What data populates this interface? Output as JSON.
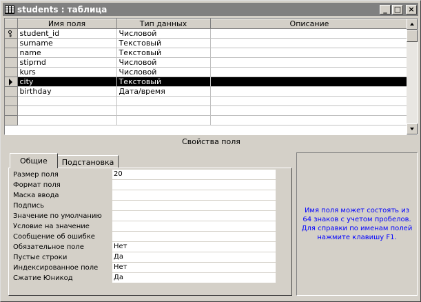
{
  "window": {
    "title": "students : таблица"
  },
  "columns": {
    "field_name": "Имя поля",
    "data_type": "Тип данных",
    "description": "Описание"
  },
  "fields": [
    {
      "name": "student_id",
      "type": "Числовой",
      "description": ""
    },
    {
      "name": "surname",
      "type": "Текстовый",
      "description": ""
    },
    {
      "name": "name",
      "type": "Текстовый",
      "description": ""
    },
    {
      "name": "stiprnd",
      "type": "Числовой",
      "description": ""
    },
    {
      "name": "kurs",
      "type": "Числовой",
      "description": ""
    },
    {
      "name": "city",
      "type": "Текстовый",
      "description": ""
    },
    {
      "name": "birthday",
      "type": "Дата/время",
      "description": ""
    }
  ],
  "selected_field": "city",
  "primary_key": "student_id",
  "properties_caption": "Свойства поля",
  "tabs": [
    {
      "label": "Общие"
    },
    {
      "label": "Подстановка"
    }
  ],
  "properties": [
    {
      "label": "Размер поля",
      "value": "20"
    },
    {
      "label": "Формат поля",
      "value": ""
    },
    {
      "label": "Маска ввода",
      "value": ""
    },
    {
      "label": "Подпись",
      "value": ""
    },
    {
      "label": "Значение по умолчанию",
      "value": ""
    },
    {
      "label": "Условие на значение",
      "value": ""
    },
    {
      "label": "Сообщение об ошибке",
      "value": ""
    },
    {
      "label": "Обязательное поле",
      "value": "Нет"
    },
    {
      "label": "Пустые строки",
      "value": "Да"
    },
    {
      "label": "Индексированное поле",
      "value": "Нет"
    },
    {
      "label": "Сжатие Юникод",
      "value": "Да"
    }
  ],
  "help_text": "Имя поля может состоять из 64 знаков с учетом пробелов.  Для справки по именам полей нажмите клавишу F1.",
  "colors": {
    "help_text": "#0000ff",
    "title_inactive": "#808080",
    "selection": "#000000"
  }
}
